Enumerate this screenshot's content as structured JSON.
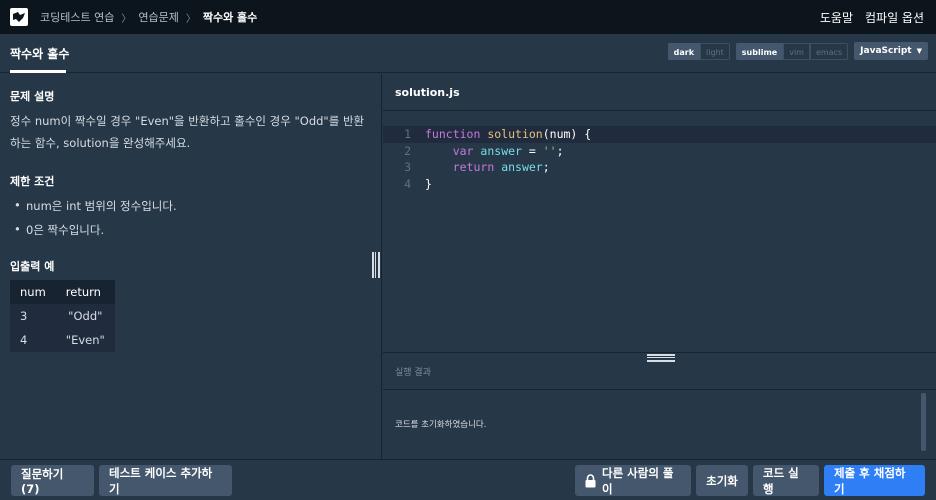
{
  "nav": {
    "breadcrumbs": [
      "코딩테스트 연습",
      "연습문제",
      "짝수와 홀수"
    ],
    "right": [
      "도움말",
      "컴파일 옵션"
    ]
  },
  "tabbar": {
    "tab": "짝수와 홀수",
    "theme_options": [
      "dark",
      "light"
    ],
    "theme_selected": "dark",
    "keymap_options": [
      "sublime",
      "vim",
      "emacs"
    ],
    "keymap_selected": "sublime",
    "language": "JavaScript"
  },
  "problem": {
    "desc_title": "문제 설명",
    "description": "정수 num이 짝수일 경우 \"Even\"을 반환하고 홀수인 경우 \"Odd\"를 반환하는 함수, solution을 완성해주세요.",
    "constraints_title": "제한 조건",
    "constraints": [
      "num은 int 범위의 정수입니다.",
      "0은 짝수입니다."
    ],
    "examples_title": "입출력 예",
    "example_headers": [
      "num",
      "return"
    ],
    "example_rows": [
      [
        "3",
        "\"Odd\""
      ],
      [
        "4",
        "\"Even\""
      ]
    ]
  },
  "editor": {
    "filename": "solution.js",
    "line_numbers": [
      "1",
      "2",
      "3",
      "4"
    ],
    "lines": [
      [
        {
          "t": "function",
          "c": "kw"
        },
        {
          "t": " ",
          "c": ""
        },
        {
          "t": "solution",
          "c": "fn"
        },
        {
          "t": "(num) {",
          "c": ""
        }
      ],
      [
        {
          "t": "    ",
          "c": ""
        },
        {
          "t": "var",
          "c": "kw"
        },
        {
          "t": " ",
          "c": ""
        },
        {
          "t": "answer",
          "c": "vr"
        },
        {
          "t": " = ",
          "c": ""
        },
        {
          "t": "''",
          "c": "str"
        },
        {
          "t": ";",
          "c": ""
        }
      ],
      [
        {
          "t": "    ",
          "c": ""
        },
        {
          "t": "return",
          "c": "kw"
        },
        {
          "t": " ",
          "c": ""
        },
        {
          "t": "answer",
          "c": "vr"
        },
        {
          "t": ";",
          "c": ""
        }
      ],
      [
        {
          "t": "}",
          "c": ""
        }
      ]
    ]
  },
  "result": {
    "label": "실행 결과",
    "message": "코드를 초기화하였습니다."
  },
  "buttons": {
    "question": "질문하기 (7)",
    "add_testcase": "테스트 케이스 추가하기",
    "others_solution": "다른 사람의 풀이",
    "reset": "초기화",
    "run": "코드 실행",
    "submit": "제출 후 채점하기"
  },
  "colors": {
    "background": "#263747",
    "topnav": "#0c151c",
    "button": "#44576c",
    "primary": "#2e7ef5"
  }
}
